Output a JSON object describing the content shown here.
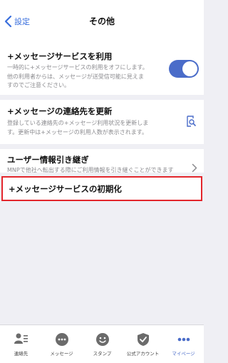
{
  "header": {
    "back_label": "設定",
    "title": "その他"
  },
  "sections": {
    "service": {
      "title": "+メッセージサービスを利用",
      "desc": [
        "一時的に+メッセージサービスの利用をオフにします。",
        "他の利用者からは、メッセージが送受信可能に見えま",
        "すのでご注意ください。"
      ],
      "toggle_on": true
    },
    "contacts": {
      "title": "+メッセージの連絡先を更新",
      "desc": [
        "登録している連絡先の+メッセージ利用状況を更新しま",
        "す。更新中は+メッセージの利用人数が表示されます。"
      ]
    },
    "transfer": {
      "title": "ユーザー情報引き継ぎ",
      "desc": [
        "MNPで他社へ転出する際にご利用情報を引き継ぐことができます"
      ]
    },
    "reset": {
      "title": "+メッセージサービスの初期化"
    }
  },
  "tabbar": {
    "items": [
      {
        "label": "連絡先",
        "icon": "contacts-icon"
      },
      {
        "label": "メッセージ",
        "icon": "message-icon"
      },
      {
        "label": "スタンプ",
        "icon": "stamp-icon"
      },
      {
        "label": "公式アカウント",
        "icon": "official-account-icon"
      },
      {
        "label": "マイページ",
        "icon": "mypage-icon",
        "active": true
      }
    ]
  },
  "colors": {
    "accent": "#4a6cc9",
    "highlight": "#e3262c",
    "back": "#3a6fdd"
  }
}
